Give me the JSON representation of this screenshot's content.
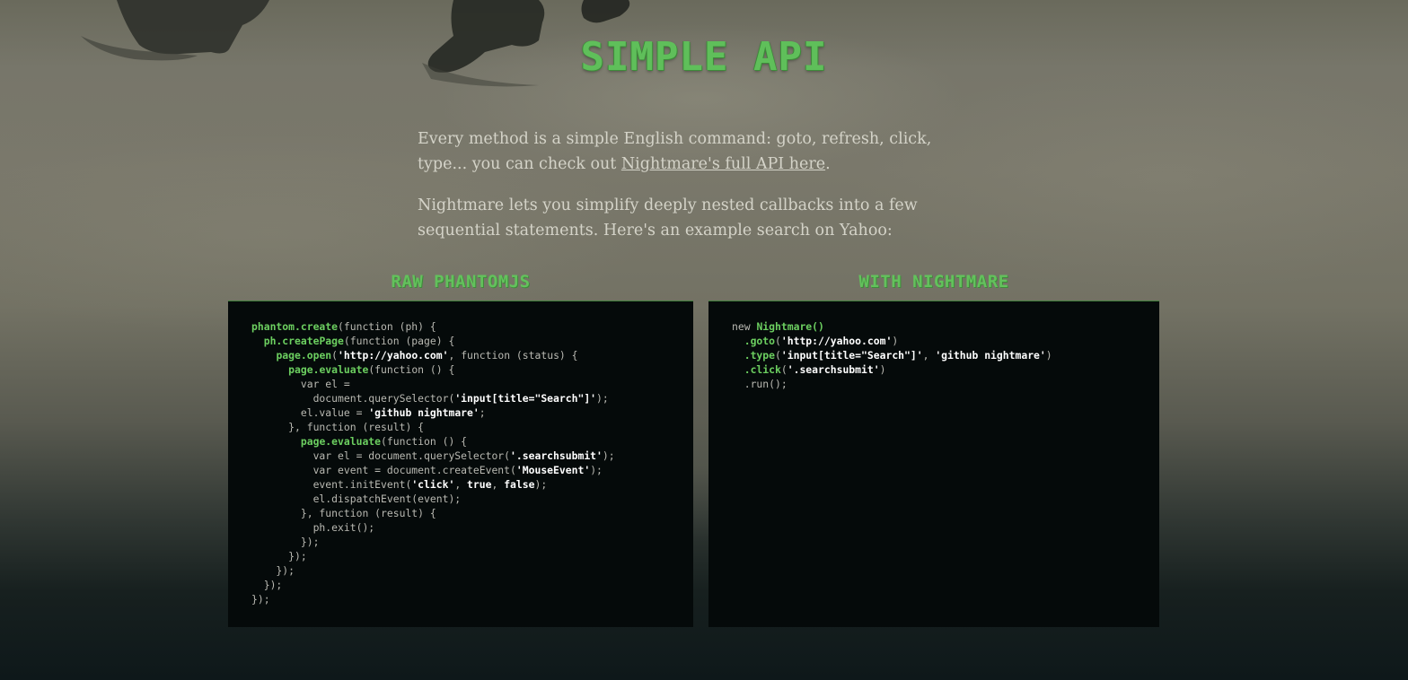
{
  "section": {
    "title": "SIMPLE API"
  },
  "intro": {
    "p1_before": "Every method is a simple English command: goto, refresh, click, type... you can check out ",
    "p1_link": "Nightmare's full API here",
    "p1_after": ".",
    "p2": "Nightmare lets you simplify deeply nested callbacks into a few sequential statements. Here's an example search on Yahoo:"
  },
  "columns": [
    {
      "title": "RAW PHANTOMJS",
      "code": [
        [
          [
            "g",
            "phantom.create"
          ],
          [
            "n",
            "(function (ph) {"
          ]
        ],
        [
          [
            "n",
            "  "
          ],
          [
            "g",
            "ph.createPage"
          ],
          [
            "n",
            "(function (page) {"
          ]
        ],
        [
          [
            "n",
            "    "
          ],
          [
            "g",
            "page.open"
          ],
          [
            "n",
            "("
          ],
          [
            "s",
            "'http://yahoo.com'"
          ],
          [
            "n",
            ", function (status) {"
          ]
        ],
        [
          [
            "n",
            "      "
          ],
          [
            "g",
            "page.evaluate"
          ],
          [
            "n",
            "(function () {"
          ]
        ],
        [
          [
            "n",
            "        var el ="
          ]
        ],
        [
          [
            "n",
            "          document.querySelector("
          ],
          [
            "s",
            "'input[title=\"Search\"]'"
          ],
          [
            "n",
            ");"
          ]
        ],
        [
          [
            "n",
            "        el.value = "
          ],
          [
            "s",
            "'github nightmare'"
          ],
          [
            "n",
            ";"
          ]
        ],
        [
          [
            "n",
            "      }, function (result) {"
          ]
        ],
        [
          [
            "n",
            "        "
          ],
          [
            "g",
            "page.evaluate"
          ],
          [
            "n",
            "(function () {"
          ]
        ],
        [
          [
            "n",
            "          var el = document.querySelector("
          ],
          [
            "s",
            "'.searchsubmit'"
          ],
          [
            "n",
            ");"
          ]
        ],
        [
          [
            "n",
            "          var event = document.createEvent("
          ],
          [
            "s",
            "'MouseEvent'"
          ],
          [
            "n",
            ");"
          ]
        ],
        [
          [
            "n",
            "          event.initEvent("
          ],
          [
            "s",
            "'click'"
          ],
          [
            "n",
            ", "
          ],
          [
            "s",
            "true"
          ],
          [
            "n",
            ", "
          ],
          [
            "s",
            "false"
          ],
          [
            "n",
            ");"
          ]
        ],
        [
          [
            "n",
            "          el.dispatchEvent(event);"
          ]
        ],
        [
          [
            "n",
            "        }, function (result) {"
          ]
        ],
        [
          [
            "n",
            "          ph.exit();"
          ]
        ],
        [
          [
            "n",
            "        });"
          ]
        ],
        [
          [
            "n",
            "      });"
          ]
        ],
        [
          [
            "n",
            "    });"
          ]
        ],
        [
          [
            "n",
            "  });"
          ]
        ],
        [
          [
            "n",
            "});"
          ]
        ]
      ]
    },
    {
      "title": "WITH NIGHTMARE",
      "code": [
        [
          [
            "n",
            "new "
          ],
          [
            "g",
            "Nightmare()"
          ]
        ],
        [
          [
            "n",
            "  "
          ],
          [
            "g",
            ".goto"
          ],
          [
            "n",
            "("
          ],
          [
            "s",
            "'http://yahoo.com'"
          ],
          [
            "n",
            ")"
          ]
        ],
        [
          [
            "n",
            "  "
          ],
          [
            "g",
            ".type"
          ],
          [
            "n",
            "("
          ],
          [
            "s",
            "'input[title=\"Search\"]'"
          ],
          [
            "n",
            ", "
          ],
          [
            "s",
            "'github nightmare'"
          ],
          [
            "n",
            ")"
          ]
        ],
        [
          [
            "n",
            "  "
          ],
          [
            "g",
            ".click"
          ],
          [
            "n",
            "("
          ],
          [
            "s",
            "'.searchsubmit'"
          ],
          [
            "n",
            ")"
          ]
        ],
        [
          [
            "n",
            "  .run();"
          ]
        ]
      ]
    }
  ],
  "colors": {
    "accent_green": "#63c15c",
    "code_background": "#050a0a",
    "code_text": "#b9b9b2",
    "code_string": "#ffffff"
  }
}
